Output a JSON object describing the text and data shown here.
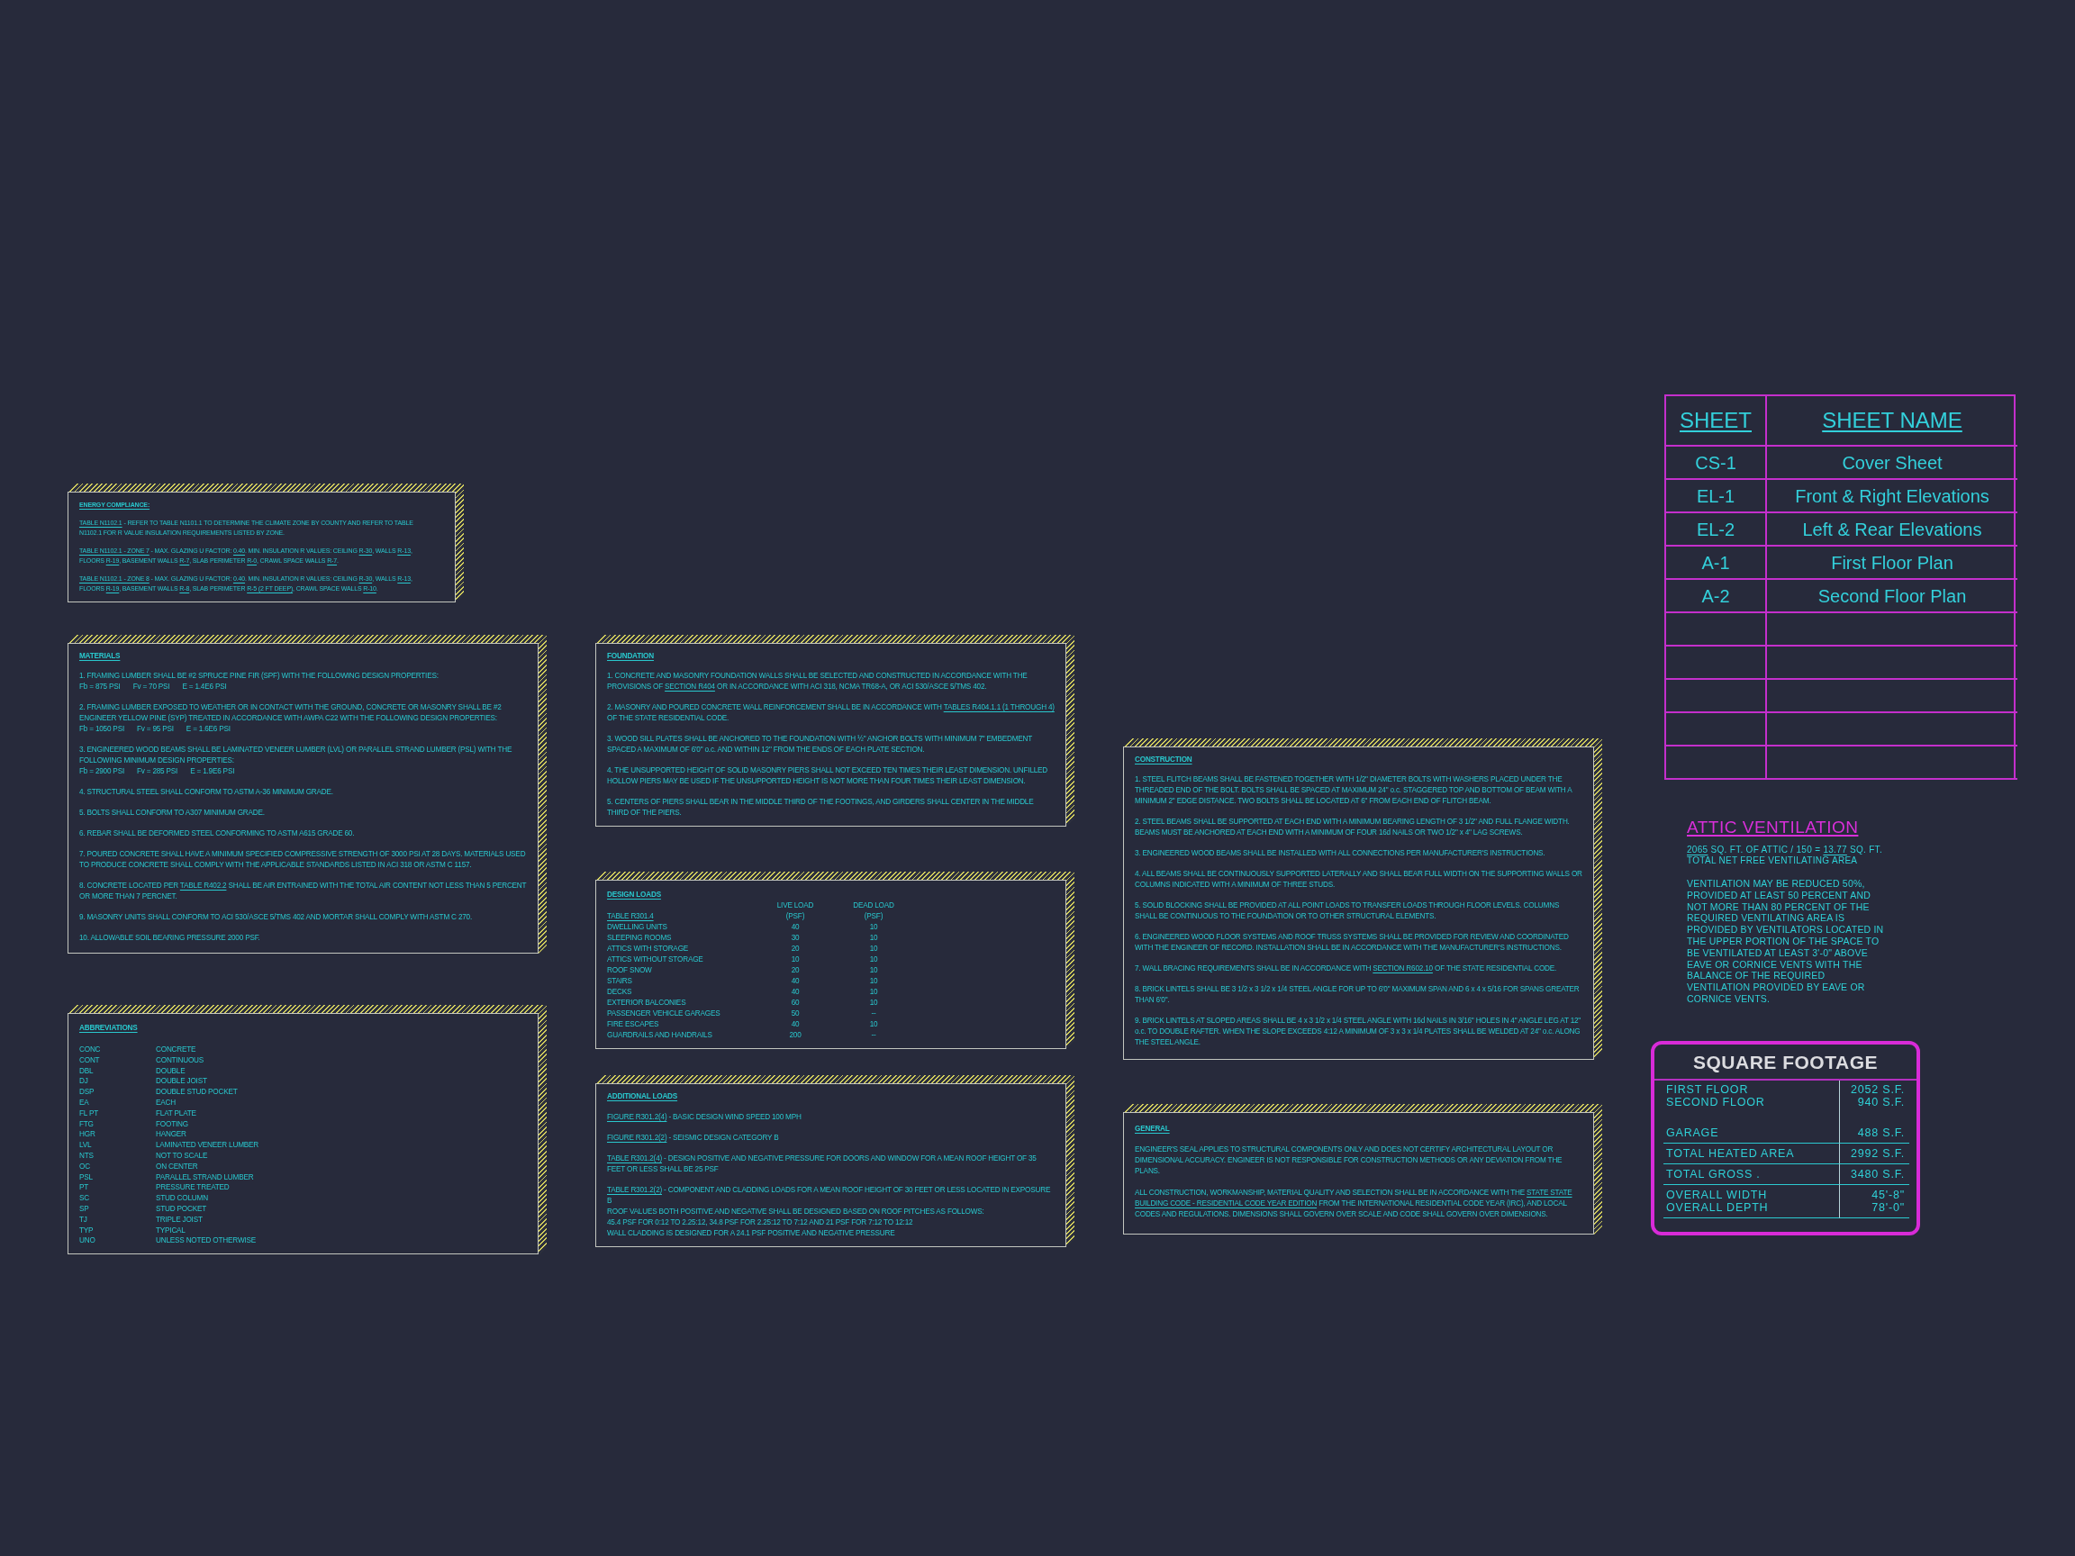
{
  "energy_compliance": {
    "heading": "ENERGY COMPLIANCE:",
    "notes": [
      {
        "segments": [
          {
            "text": "TABLE N1102.1",
            "kind": "underlined"
          },
          {
            "text": " - REFER TO TABLE N1101.1 TO DETERMINE THE CLIMATE ZONE BY COUNTY AND REFER TO TABLE N1102.1 FOR R VALUE INSULATION REQUIREMENTS LISTED BY ZONE.",
            "kind": "plain"
          }
        ]
      },
      {
        "segments": [
          {
            "text": "TABLE N1102.1 - ZONE 7",
            "kind": "underlined"
          },
          {
            "text": " - MAX. GLAZING U FACTOR: ",
            "kind": "plain"
          },
          {
            "text": "0.40",
            "kind": "underlined"
          },
          {
            "text": ". MIN. INSULATION R VALUES: CEILING ",
            "kind": "plain"
          },
          {
            "text": "R-30",
            "kind": "underlined"
          },
          {
            "text": ", WALLS ",
            "kind": "plain"
          },
          {
            "text": "R-13",
            "kind": "underlined"
          },
          {
            "text": ", FLOORS ",
            "kind": "plain"
          },
          {
            "text": "R-19",
            "kind": "underlined"
          },
          {
            "text": ", BASEMENT WALLS ",
            "kind": "plain"
          },
          {
            "text": "R-7",
            "kind": "underlined"
          },
          {
            "text": ", SLAB PERIMETER ",
            "kind": "plain"
          },
          {
            "text": "R-0",
            "kind": "underlined"
          },
          {
            "text": ", CRAWL SPACE WALLS ",
            "kind": "plain"
          },
          {
            "text": "R-7",
            "kind": "underlined"
          },
          {
            "text": ".",
            "kind": "plain"
          }
        ]
      },
      {
        "segments": [
          {
            "text": "TABLE N1102.1 - ZONE 8",
            "kind": "underlined"
          },
          {
            "text": " - MAX. GLAZING U FACTOR: ",
            "kind": "plain"
          },
          {
            "text": "0.40",
            "kind": "underlined"
          },
          {
            "text": ". MIN. INSULATION R VALUES: CEILING ",
            "kind": "plain"
          },
          {
            "text": "R-30",
            "kind": "underlined"
          },
          {
            "text": ", WALLS ",
            "kind": "plain"
          },
          {
            "text": "R-13",
            "kind": "underlined"
          },
          {
            "text": ", FLOORS ",
            "kind": "plain"
          },
          {
            "text": "R-19",
            "kind": "underlined"
          },
          {
            "text": ", BASEMENT WALLS ",
            "kind": "plain"
          },
          {
            "text": "R-8",
            "kind": "underlined"
          },
          {
            "text": ", SLAB PERIMETER ",
            "kind": "plain"
          },
          {
            "text": "R-5 (2 FT DEEP)",
            "kind": "underlined"
          },
          {
            "text": ", CRAWL SPACE WALLS ",
            "kind": "plain"
          },
          {
            "text": "R-10",
            "kind": "underlined"
          },
          {
            "text": ".",
            "kind": "plain"
          }
        ]
      }
    ]
  },
  "materials": {
    "heading": "MATERIALS",
    "notes": [
      {
        "segments": [
          {
            "text": "1. FRAMING LUMBER SHALL BE #2 SPRUCE PINE FIR (SPF) WITH THE FOLLOWING DESIGN PROPERTIES:",
            "kind": "plain"
          }
        ],
        "properties": [
          "Fb = 875 PSI",
          "Fv = 70 PSI",
          "E = 1.4E6 PSI"
        ]
      },
      {
        "segments": [
          {
            "text": "2. FRAMING LUMBER EXPOSED TO WEATHER OR IN CONTACT WITH THE GROUND, CONCRETE OR MASONRY SHALL BE #2 ENGINEER YELLOW PINE (SYP) TREATED IN ACCORDANCE WITH AWPA C22 WITH THE FOLLOWING DESIGN PROPERTIES:",
            "kind": "plain"
          }
        ],
        "properties": [
          "Fb = 1050 PSI",
          "Fv = 95 PSI",
          "E = 1.6E6 PSI"
        ]
      },
      {
        "segments": [
          {
            "text": "3. ENGINEERED WOOD BEAMS SHALL BE LAMINATED VENEER LUMBER (LVL) OR PARALLEL STRAND LUMBER (PSL) WITH THE FOLLOWING MINIMUM DESIGN PROPERTIES:",
            "kind": "plain"
          }
        ],
        "properties": [
          "Fb = 2900 PSI",
          "Fv = 285 PSI",
          "E = 1.9E6 PSI"
        ]
      },
      {
        "segments": [
          {
            "text": "4. STRUCTURAL STEEL SHALL CONFORM TO ASTM A-36 MINIMUM GRADE.",
            "kind": "plain"
          }
        ]
      },
      {
        "segments": [
          {
            "text": "5. BOLTS SHALL CONFORM TO A307 MINIMUM GRADE.",
            "kind": "plain"
          }
        ]
      },
      {
        "segments": [
          {
            "text": "6. REBAR SHALL BE DEFORMED STEEL CONFORMING TO ASTM A615 GRADE 60.",
            "kind": "plain"
          }
        ]
      },
      {
        "segments": [
          {
            "text": "7. POURED CONCRETE SHALL HAVE A MINIMUM SPECIFIED COMPRESSIVE STRENGTH OF 3000 PSI AT 28 DAYS. MATERIALS USED TO PRODUCE CONCRETE SHALL COMPLY WITH THE APPLICABLE STANDARDS LISTED IN ACI 318 OR ASTM C 1157.",
            "kind": "plain"
          }
        ]
      },
      {
        "segments": [
          {
            "text": "8. CONCRETE LOCATED PER ",
            "kind": "plain"
          },
          {
            "text": "TABLE R402.2",
            "kind": "underlined"
          },
          {
            "text": " SHALL BE AIR ENTRAINED WITH THE TOTAL AIR CONTENT NOT LESS THAN 5 PERCENT OR MORE THAN 7 PERCNET.",
            "kind": "plain"
          }
        ]
      },
      {
        "segments": [
          {
            "text": "9. MASONRY UNITS SHALL CONFORM TO ACI 530/ASCE 5/TMS 402 AND MORTAR SHALL COMPLY WITH ASTM C 270.",
            "kind": "plain"
          }
        ]
      },
      {
        "segments": [
          {
            "text": "10. ALLOWABLE SOIL BEARING PRESSURE 2000 PSF.",
            "kind": "plain"
          }
        ]
      }
    ]
  },
  "abbreviations": {
    "heading": "ABBREVIATIONS",
    "items": [
      {
        "abbr": "CONC",
        "meaning": "CONCRETE"
      },
      {
        "abbr": "CONT",
        "meaning": "CONTINUOUS"
      },
      {
        "abbr": "DBL",
        "meaning": "DOUBLE"
      },
      {
        "abbr": "DJ",
        "meaning": "DOUBLE JOIST"
      },
      {
        "abbr": "DSP",
        "meaning": "DOUBLE STUD POCKET"
      },
      {
        "abbr": "EA",
        "meaning": "EACH"
      },
      {
        "abbr": "FL PT",
        "meaning": "FLAT PLATE"
      },
      {
        "abbr": "FTG",
        "meaning": "FOOTING"
      },
      {
        "abbr": "HGR",
        "meaning": "HANGER"
      },
      {
        "abbr": "LVL",
        "meaning": "LAMINATED VENEER LUMBER"
      },
      {
        "abbr": "NTS",
        "meaning": "NOT TO SCALE"
      },
      {
        "abbr": "OC",
        "meaning": "ON CENTER"
      },
      {
        "abbr": "PSL",
        "meaning": "PARALLEL STRAND LUMBER"
      },
      {
        "abbr": "PT",
        "meaning": "PRESSURE TREATED"
      },
      {
        "abbr": "SC",
        "meaning": "STUD COLUMN"
      },
      {
        "abbr": "SP",
        "meaning": "STUD POCKET"
      },
      {
        "abbr": "TJ",
        "meaning": "TRIPLE JOIST"
      },
      {
        "abbr": "TYP",
        "meaning": "TYPICAL"
      },
      {
        "abbr": "UNO",
        "meaning": "UNLESS NOTED OTHERWISE"
      }
    ]
  },
  "foundation": {
    "heading": "FOUNDATION",
    "notes": [
      {
        "segments": [
          {
            "text": "1. CONCRETE AND MASONRY FOUNDATION WALLS SHALL BE SELECTED AND CONSTRUCTED IN ACCORDANCE WITH THE PROVISIONS OF ",
            "kind": "plain"
          },
          {
            "text": "SECTION R404",
            "kind": "underlined"
          },
          {
            "text": " OR IN ACCORDANCE WITH ACI 318, NCMA TR68-A, OR ACI 530/ASCE 5/TMS 402.",
            "kind": "plain"
          }
        ]
      },
      {
        "segments": [
          {
            "text": "2. MASONRY AND POURED CONCRETE WALL REINFORCEMENT SHALL BE IN ACCORDANCE WITH ",
            "kind": "plain"
          },
          {
            "text": "TABLES R404.1.1 (1 THROUGH 4)",
            "kind": "underlined"
          },
          {
            "text": " OF THE STATE RESIDENTIAL CODE.",
            "kind": "plain"
          }
        ]
      },
      {
        "segments": [
          {
            "text": "3. WOOD SILL PLATES SHALL BE ANCHORED TO THE FOUNDATION WITH ½\" ANCHOR BOLTS WITH MINIMUM 7\" EMBEDMENT SPACED A MAXIMUM OF 6'0\" o.c. AND WITHIN 12\" FROM THE ENDS OF EACH PLATE SECTION.",
            "kind": "plain"
          }
        ]
      },
      {
        "segments": [
          {
            "text": "4. THE UNSUPPORTED HEIGHT OF SOLID MASONRY PIERS SHALL NOT EXCEED TEN TIMES THEIR LEAST DIMENSION. UNFILLED HOLLOW PIERS MAY BE USED IF THE UNSUPPORTED HEIGHT IS NOT MORE THAN FOUR TIMES THEIR LEAST DIMENSION.",
            "kind": "plain"
          }
        ]
      },
      {
        "segments": [
          {
            "text": "5. CENTERS OF PIERS SHALL BEAR IN THE MIDDLE THIRD OF THE FOOTINGS, AND GIRDERS SHALL CENTER IN THE MIDDLE THIRD OF THE PIERS.",
            "kind": "plain"
          }
        ]
      }
    ]
  },
  "design_loads": {
    "heading": "DESIGN LOADS",
    "table_label": "TABLE R301.4",
    "columns": [
      {
        "name": "LIVE LOAD",
        "unit": "(PSF)"
      },
      {
        "name": "DEAD LOAD",
        "unit": "(PSF)"
      }
    ],
    "rows": [
      {
        "use": "DWELLING UNITS",
        "live": "40",
        "dead": "10"
      },
      {
        "use": "SLEEPING ROOMS",
        "live": "30",
        "dead": "10"
      },
      {
        "use": "ATTICS WITH STORAGE",
        "live": "20",
        "dead": "10"
      },
      {
        "use": "ATTICS WITHOUT STORAGE",
        "live": "10",
        "dead": "10"
      },
      {
        "use": "ROOF SNOW",
        "live": "20",
        "dead": "10"
      },
      {
        "use": "STAIRS",
        "live": "40",
        "dead": "10"
      },
      {
        "use": "DECKS",
        "live": "40",
        "dead": "10"
      },
      {
        "use": "EXTERIOR BALCONIES",
        "live": "60",
        "dead": "10"
      },
      {
        "use": "PASSENGER VEHICLE GARAGES",
        "live": "50",
        "dead": "--"
      },
      {
        "use": "FIRE ESCAPES",
        "live": "40",
        "dead": "10"
      },
      {
        "use": "GUARDRAILS AND HANDRAILS",
        "live": "200",
        "dead": "--"
      }
    ]
  },
  "additional_loads": {
    "heading": "ADDITIONAL LOADS",
    "notes": [
      {
        "segments": [
          {
            "text": "FIGURE R301.2(4)",
            "kind": "underlined"
          },
          {
            "text": " - BASIC DESIGN WIND SPEED 100 MPH",
            "kind": "plain"
          }
        ]
      },
      {
        "segments": [
          {
            "text": "FIGURE R301.2(2)",
            "kind": "underlined"
          },
          {
            "text": " - SEISMIC DESIGN CATEGORY B",
            "kind": "plain"
          }
        ]
      },
      {
        "segments": [
          {
            "text": "TABLE R301.2(4)",
            "kind": "underlined"
          },
          {
            "text": " - DESIGN POSITIVE AND NEGATIVE PRESSURE FOR DOORS AND WINDOW FOR A MEAN ROOF HEIGHT OF 35 FEET OR LESS SHALL BE 25 PSF",
            "kind": "plain"
          }
        ]
      },
      {
        "segments": [
          {
            "text": "TABLE R301.2(2)",
            "kind": "underlined"
          },
          {
            "text": " - COMPONENT AND CLADDING LOADS FOR A MEAN ROOF HEIGHT OF 30 FEET OR LESS LOCATED IN EXPOSURE B",
            "kind": "plain"
          }
        ],
        "continuation": [
          "ROOF VALUES BOTH POSITIVE AND NEGATIVE SHALL BE DESIGNED BASED ON ROOF PITCHES AS FOLLOWS:",
          "45.4 PSF FOR 0:12 TO 2.25:12, 34.8 PSF FOR 2.25:12 TO 7:12 AND 21 PSF FOR 7:12 TO 12:12",
          "WALL CLADDING IS DESIGNED FOR A 24.1 PSF POSITIVE AND NEGATIVE PRESSURE"
        ]
      }
    ]
  },
  "construction": {
    "heading": "CONSTRUCTION",
    "notes": [
      {
        "segments": [
          {
            "text": "1. STEEL FLITCH BEAMS SHALL BE FASTENED TOGETHER WITH 1/2\" DIAMETER BOLTS WITH WASHERS PLACED UNDER THE THREADED END OF THE BOLT. BOLTS SHALL BE SPACED AT MAXIMUM 24\" o.c. STAGGERED TOP AND BOTTOM OF BEAM WITH A MINIMUM 2\" EDGE DISTANCE. TWO BOLTS SHALL BE LOCATED AT 6\" FROM EACH END OF FLITCH BEAM.",
            "kind": "plain"
          }
        ]
      },
      {
        "segments": [
          {
            "text": "2. STEEL BEAMS SHALL BE SUPPORTED AT EACH END WITH A MINIMUM BEARING LENGTH OF 3 1/2\" AND FULL FLANGE WIDTH. BEAMS MUST BE ANCHORED AT EACH END WITH A MINIMUM OF FOUR 16d NAILS OR TWO 1/2\" x 4\" LAG SCREWS.",
            "kind": "plain"
          }
        ]
      },
      {
        "segments": [
          {
            "text": "3. ENGINEERED WOOD BEAMS SHALL BE INSTALLED WITH ALL CONNECTIONS PER MANUFACTURER'S INSTRUCTIONS.",
            "kind": "plain"
          }
        ]
      },
      {
        "segments": [
          {
            "text": "4. ALL BEAMS SHALL BE CONTINUOUSLY SUPPORTED LATERALLY AND SHALL BEAR FULL WIDTH ON THE SUPPORTING WALLS OR COLUMNS INDICATED WITH A MINIMUM OF THREE STUDS.",
            "kind": "plain"
          }
        ]
      },
      {
        "segments": [
          {
            "text": "5. SOLID BLOCKING SHALL BE PROVIDED AT ALL POINT LOADS TO TRANSFER LOADS THROUGH FLOOR LEVELS. COLUMNS SHALL BE CONTINUOUS TO THE FOUNDATION OR TO OTHER STRUCTURAL ELEMENTS.",
            "kind": "plain"
          }
        ]
      },
      {
        "segments": [
          {
            "text": "6. ENGINEERED WOOD FLOOR SYSTEMS AND ROOF TRUSS SYSTEMS SHALL BE PROVIDED FOR REVIEW AND COORDINATED WITH THE ENGINEER OF RECORD. INSTALLATION SHALL BE IN ACCORDANCE WITH THE MANUFACTURER'S INSTRUCTIONS.",
            "kind": "plain"
          }
        ]
      },
      {
        "segments": [
          {
            "text": "7. WALL BRACING REQUIREMENTS SHALL BE IN ACCORDANCE WITH ",
            "kind": "plain"
          },
          {
            "text": "SECTION R602.10",
            "kind": "underlined"
          },
          {
            "text": " OF THE STATE RESIDENTIAL CODE.",
            "kind": "plain"
          }
        ]
      },
      {
        "segments": [
          {
            "text": "8. BRICK LINTELS SHALL BE 3 1/2 x 3 1/2 x 1/4 STEEL ANGLE FOR UP TO 6'0\" MAXIMUM SPAN AND 6 x 4 x 5/16 FOR SPANS GREATER THAN 6'0\".",
            "kind": "plain"
          }
        ]
      },
      {
        "segments": [
          {
            "text": "9. BRICK LINTELS AT SLOPED AREAS SHALL BE 4 x 3 1/2 x 1/4 STEEL ANGLE WITH 16d NAILS IN 3/16\" HOLES IN 4\" ANGLE LEG AT 12\" o.c. TO DOUBLE RAFTER. WHEN THE SLOPE EXCEEDS 4:12 A MINIMUM OF 3 x 3 x 1/4 PLATES SHALL BE WELDED AT 24\" o.c. ALONG THE STEEL ANGLE.",
            "kind": "plain"
          }
        ]
      }
    ]
  },
  "general": {
    "heading": "GENERAL",
    "notes": [
      {
        "segments": [
          {
            "text": "ENGINEER'S SEAL APPLIES TO STRUCTURAL COMPONENTS ONLY AND DOES NOT CERTIFY ARCHITECTURAL LAYOUT OR DIMENSIONAL ACCURACY. ENGINEER IS NOT RESPONSIBLE FOR CONSTRUCTION METHODS OR ANY DEVIATION FROM THE PLANS.",
            "kind": "plain"
          }
        ]
      },
      {
        "segments": [
          {
            "text": "ALL CONSTRUCTION, WORKMANSHIP, MATERIAL QUALITY AND SELECTION SHALL BE IN ACCORDANCE WITH THE ",
            "kind": "plain"
          },
          {
            "text": "STATE STATE BUILDING CODE - RESIDENTIAL CODE YEAR EDITION",
            "kind": "underlined"
          },
          {
            "text": " FROM THE INTERNATIONAL RESIDENTIAL CODE YEAR (IRC), AND LOCAL CODES AND REGULATIONS. DIMENSIONS SHALL GOVERN OVER SCALE AND CODE SHALL GOVERN OVER DIMENSIONS.",
            "kind": "plain"
          }
        ]
      }
    ]
  },
  "sheet_index": {
    "columns": [
      "SHEET",
      "SHEET NAME"
    ],
    "rows": [
      {
        "sheet": "CS-1",
        "name": "Cover Sheet"
      },
      {
        "sheet": "EL-1",
        "name": "Front & Right Elevations"
      },
      {
        "sheet": "EL-2",
        "name": "Left & Rear Elevations"
      },
      {
        "sheet": "A-1",
        "name": "First Floor Plan"
      },
      {
        "sheet": "A-2",
        "name": "Second Floor Plan"
      }
    ]
  },
  "attic_ventilation": {
    "title": "ATTIC VENTILATION",
    "calculation": [
      {
        "text": "2065",
        "kind": "underlined"
      },
      {
        "text": " SQ. FT. OF ATTIC / 150 = ",
        "kind": "plain"
      },
      {
        "text": "13.77",
        "kind": "underlined"
      },
      {
        "text": " SQ. FT.",
        "kind": "plain"
      }
    ],
    "caption": "TOTAL NET FREE VENTILATING AREA",
    "note": "VENTILATION MAY BE REDUCED 50%, PROVIDED AT LEAST 50 PERCENT AND NOT MORE THAN 80 PERCENT OF THE REQUIRED VENTILATING AREA IS PROVIDED BY VENTILATORS LOCATED IN THE UPPER PORTION OF THE SPACE TO BE VENTILATED AT LEAST 3'-0\" ABOVE EAVE OR CORNICE VENTS WITH THE BALANCE OF THE REQUIRED VENTILATION PROVIDED BY EAVE OR CORNICE VENTS."
  },
  "square_footage": {
    "title": "SQUARE FOOTAGE",
    "groups": [
      {
        "rows": [
          {
            "label": "FIRST FLOOR",
            "value": "2052 S.F."
          },
          {
            "label": "SECOND FLOOR",
            "value": "940 S.F."
          }
        ]
      },
      {
        "rows": [
          {
            "label": "GARAGE",
            "value": "488 S.F."
          }
        ]
      },
      {
        "rows": [
          {
            "label": "TOTAL HEATED AREA",
            "value": "2992 S.F."
          }
        ]
      },
      {
        "rows": [
          {
            "label": "TOTAL GROSS .",
            "value": "3480 S.F."
          }
        ]
      },
      {
        "rows": [
          {
            "label": "OVERALL WIDTH",
            "value": "45'-8\""
          },
          {
            "label": "OVERALL DEPTH",
            "value": "78'-0\""
          }
        ]
      }
    ]
  }
}
